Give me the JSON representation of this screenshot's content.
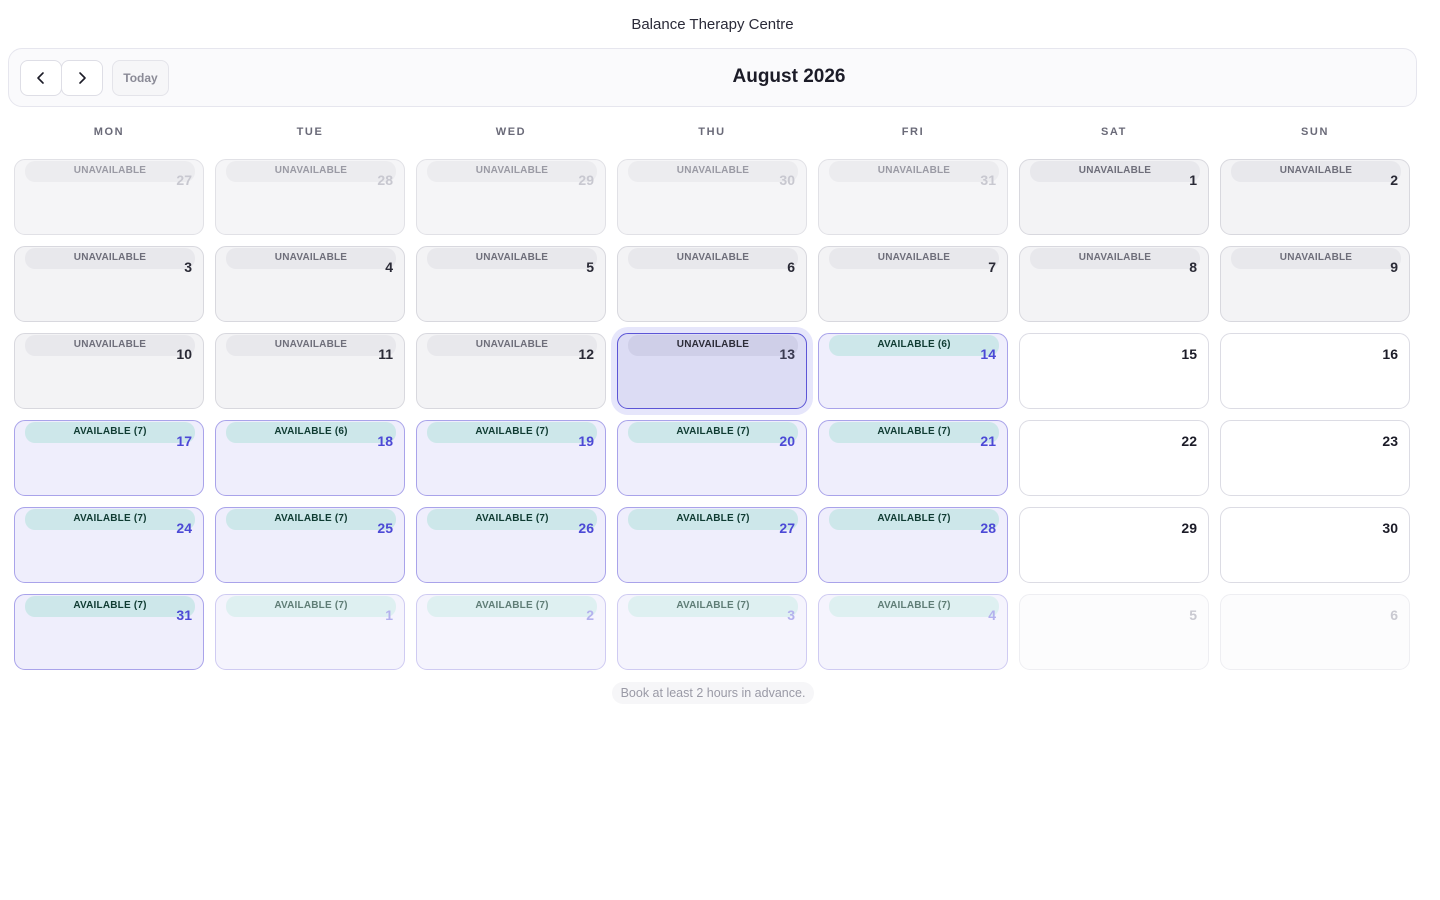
{
  "header": {
    "brand": "Balance Therapy Centre",
    "month_title": "August 2026",
    "today_label": "Today"
  },
  "weekdays": [
    "MON",
    "TUE",
    "WED",
    "THU",
    "FRI",
    "SAT",
    "SUN"
  ],
  "calendar": {
    "days": [
      {
        "day": "27",
        "status": "unavailable",
        "outside": true,
        "badge": "UNAVAILABLE"
      },
      {
        "day": "28",
        "status": "unavailable",
        "outside": true,
        "badge": "UNAVAILABLE"
      },
      {
        "day": "29",
        "status": "unavailable",
        "outside": true,
        "badge": "UNAVAILABLE"
      },
      {
        "day": "30",
        "status": "unavailable",
        "outside": true,
        "badge": "UNAVAILABLE"
      },
      {
        "day": "31",
        "status": "unavailable",
        "outside": true,
        "badge": "UNAVAILABLE"
      },
      {
        "day": "1",
        "status": "unavailable",
        "outside": false,
        "badge": "UNAVAILABLE"
      },
      {
        "day": "2",
        "status": "unavailable",
        "outside": false,
        "badge": "UNAVAILABLE"
      },
      {
        "day": "3",
        "status": "unavailable",
        "outside": false,
        "badge": "UNAVAILABLE"
      },
      {
        "day": "4",
        "status": "unavailable",
        "outside": false,
        "badge": "UNAVAILABLE"
      },
      {
        "day": "5",
        "status": "unavailable",
        "outside": false,
        "badge": "UNAVAILABLE"
      },
      {
        "day": "6",
        "status": "unavailable",
        "outside": false,
        "badge": "UNAVAILABLE"
      },
      {
        "day": "7",
        "status": "unavailable",
        "outside": false,
        "badge": "UNAVAILABLE"
      },
      {
        "day": "8",
        "status": "unavailable",
        "outside": false,
        "badge": "UNAVAILABLE"
      },
      {
        "day": "9",
        "status": "unavailable",
        "outside": false,
        "badge": "UNAVAILABLE"
      },
      {
        "day": "10",
        "status": "unavailable",
        "outside": false,
        "badge": "UNAVAILABLE"
      },
      {
        "day": "11",
        "status": "unavailable",
        "outside": false,
        "badge": "UNAVAILABLE"
      },
      {
        "day": "12",
        "status": "unavailable",
        "outside": false,
        "badge": "UNAVAILABLE"
      },
      {
        "day": "13",
        "status": "unavailable",
        "outside": false,
        "badge": "UNAVAILABLE",
        "selected": true
      },
      {
        "day": "14",
        "status": "available",
        "outside": false,
        "badge": "AVAILABLE (6)"
      },
      {
        "day": "15",
        "status": "free",
        "outside": false,
        "badge": ""
      },
      {
        "day": "16",
        "status": "free",
        "outside": false,
        "badge": ""
      },
      {
        "day": "17",
        "status": "available",
        "outside": false,
        "badge": "AVAILABLE (7)"
      },
      {
        "day": "18",
        "status": "available",
        "outside": false,
        "badge": "AVAILABLE (6)"
      },
      {
        "day": "19",
        "status": "available",
        "outside": false,
        "badge": "AVAILABLE (7)"
      },
      {
        "day": "20",
        "status": "available",
        "outside": false,
        "badge": "AVAILABLE (7)"
      },
      {
        "day": "21",
        "status": "available",
        "outside": false,
        "badge": "AVAILABLE (7)"
      },
      {
        "day": "22",
        "status": "free",
        "outside": false,
        "badge": ""
      },
      {
        "day": "23",
        "status": "free",
        "outside": false,
        "badge": ""
      },
      {
        "day": "24",
        "status": "available",
        "outside": false,
        "badge": "AVAILABLE (7)"
      },
      {
        "day": "25",
        "status": "available",
        "outside": false,
        "badge": "AVAILABLE (7)"
      },
      {
        "day": "26",
        "status": "available",
        "outside": false,
        "badge": "AVAILABLE (7)"
      },
      {
        "day": "27",
        "status": "available",
        "outside": false,
        "badge": "AVAILABLE (7)"
      },
      {
        "day": "28",
        "status": "available",
        "outside": false,
        "badge": "AVAILABLE (7)"
      },
      {
        "day": "29",
        "status": "free",
        "outside": false,
        "badge": ""
      },
      {
        "day": "30",
        "status": "free",
        "outside": false,
        "badge": ""
      },
      {
        "day": "31",
        "status": "available",
        "outside": false,
        "badge": "AVAILABLE (7)"
      },
      {
        "day": "1",
        "status": "available",
        "outside": true,
        "badge": "AVAILABLE (7)"
      },
      {
        "day": "2",
        "status": "available",
        "outside": true,
        "badge": "AVAILABLE (7)"
      },
      {
        "day": "3",
        "status": "available",
        "outside": true,
        "badge": "AVAILABLE (7)"
      },
      {
        "day": "4",
        "status": "available",
        "outside": true,
        "badge": "AVAILABLE (7)"
      },
      {
        "day": "5",
        "status": "free",
        "outside": true,
        "badge": ""
      },
      {
        "day": "6",
        "status": "free",
        "outside": true,
        "badge": ""
      }
    ]
  },
  "footer": {
    "note": "Book at least 2 hours in advance."
  },
  "icons": {
    "prev": "chevron-left-icon",
    "next": "chevron-right-icon"
  },
  "colors": {
    "accent": "#4c49d6",
    "available_bg": "#efeefc",
    "available_badge": "#cde7ea",
    "unavailable_bg": "#f3f3f5",
    "selected_border": "#5c55d6"
  }
}
